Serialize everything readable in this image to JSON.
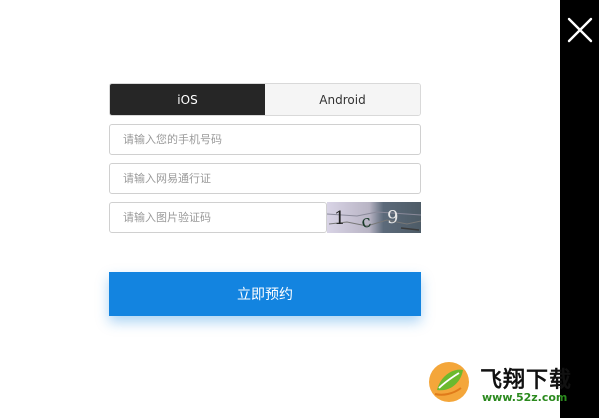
{
  "tabs": [
    {
      "label": "iOS"
    },
    {
      "label": "Android"
    }
  ],
  "form": {
    "phone_placeholder": "请输入您的手机号码",
    "passport_placeholder": "请输入网易通行证",
    "captcha_placeholder": "请输入图片验证码",
    "submit_label": "立即预约"
  },
  "watermark": {
    "title": "飞翔下载",
    "url": "www.52z.com"
  },
  "colors": {
    "accent": "#1384e0",
    "active_tab": "#262626",
    "right_strip": "#000000"
  },
  "icons": {
    "close": "close-icon",
    "logo": "leaf-logo"
  }
}
